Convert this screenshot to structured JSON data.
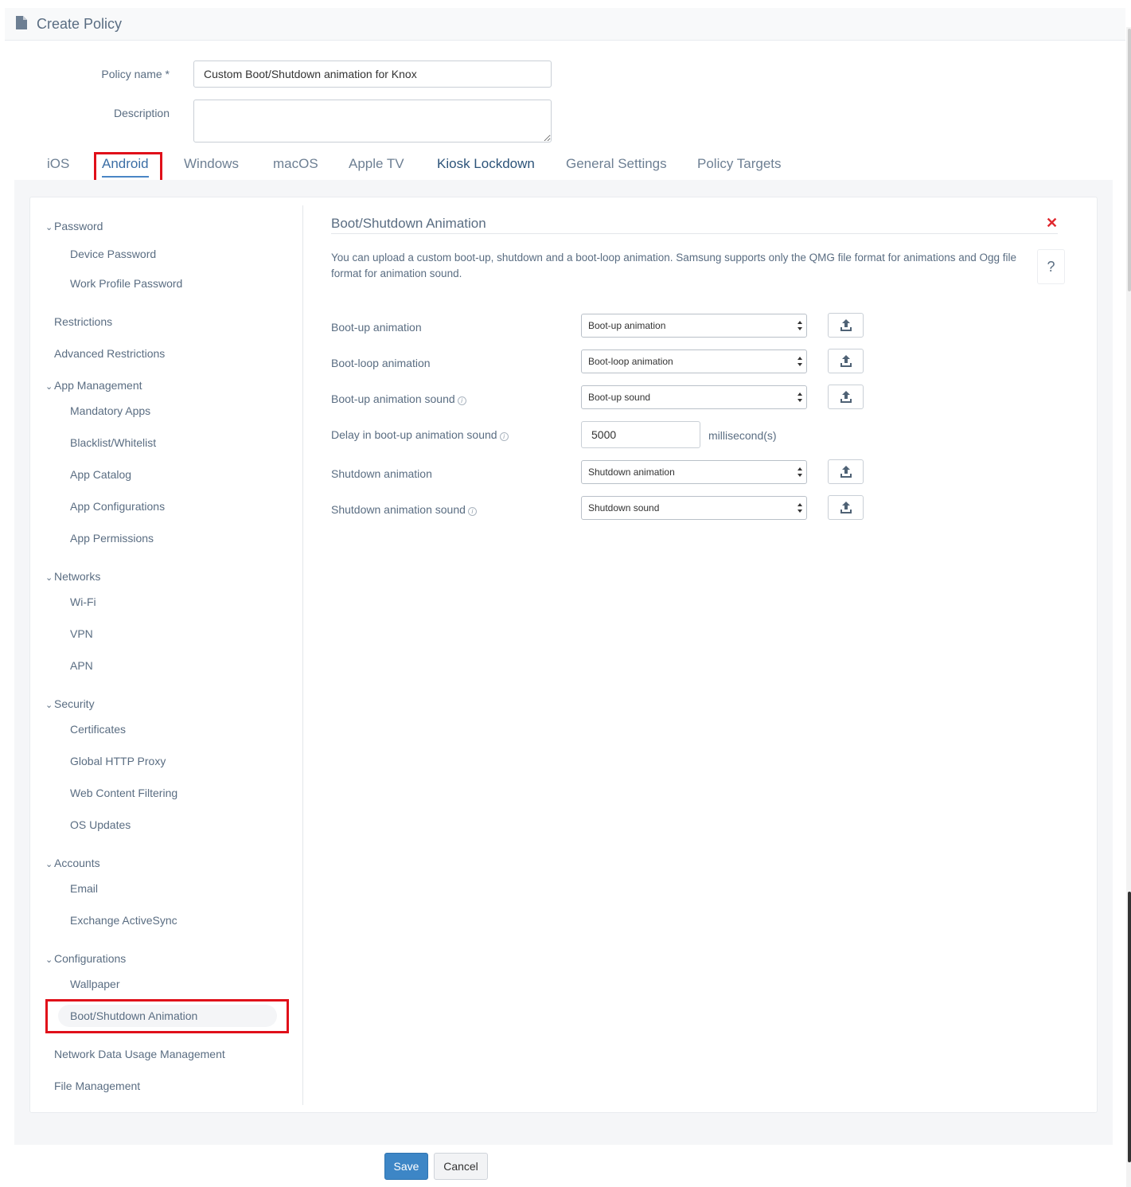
{
  "header": {
    "title": "Create Policy",
    "icon": "document-icon"
  },
  "form": {
    "policy_name_label": "Policy name *",
    "policy_name_value": "Custom Boot/Shutdown animation for Knox",
    "description_label": "Description",
    "description_value": ""
  },
  "tabs": [
    "iOS",
    "Android",
    "Windows",
    "macOS",
    "Apple TV",
    "Kiosk Lockdown",
    "General Settings",
    "Policy Targets"
  ],
  "active_tab": "Android",
  "sidebar": {
    "password": "Password",
    "device_password": "Device Password",
    "work_profile_password": "Work Profile Password",
    "restrictions": "Restrictions",
    "advanced_restrictions": "Advanced Restrictions",
    "app_management": "App Management",
    "mandatory_apps": "Mandatory Apps",
    "blacklist_whitelist": "Blacklist/Whitelist",
    "app_catalog": "App Catalog",
    "app_configurations": "App Configurations",
    "app_permissions": "App Permissions",
    "networks": "Networks",
    "wifi": "Wi-Fi",
    "vpn": "VPN",
    "apn": "APN",
    "security": "Security",
    "certificates": "Certificates",
    "global_http_proxy": "Global HTTP Proxy",
    "web_content_filtering": "Web Content Filtering",
    "os_updates": "OS Updates",
    "accounts": "Accounts",
    "email": "Email",
    "exchange_activesync": "Exchange ActiveSync",
    "configurations": "Configurations",
    "wallpaper": "Wallpaper",
    "boot_shutdown_animation": "Boot/Shutdown Animation",
    "network_data_usage": "Network Data Usage Management",
    "file_management": "File Management"
  },
  "section": {
    "title": "Boot/Shutdown Animation",
    "help": "?",
    "close": "✕",
    "description": "You can upload a custom boot-up, shutdown and a boot-loop animation. Samsung supports only the QMG file format for animations and Ogg file format for animation sound."
  },
  "fields": {
    "bootup_animation_label": "Boot-up animation",
    "bootup_animation_value": "Boot-up animation",
    "bootloop_animation_label": "Boot-loop animation",
    "bootloop_animation_value": "Boot-loop animation",
    "bootup_sound_label": "Boot-up animation sound",
    "bootup_sound_value": "Boot-up sound",
    "delay_label": "Delay in boot-up animation sound",
    "delay_value": "5000",
    "delay_unit": "millisecond(s)",
    "shutdown_animation_label": "Shutdown animation",
    "shutdown_animation_value": "Shutdown animation",
    "shutdown_sound_label": "Shutdown animation sound",
    "shutdown_sound_value": "Shutdown sound",
    "info_glyph": "i"
  },
  "footer": {
    "save": "Save",
    "cancel": "Cancel"
  },
  "colors": {
    "accent": "#3d86c6",
    "highlight": "#e0101a",
    "close": "#e0282e",
    "text": "#5a6d82"
  }
}
